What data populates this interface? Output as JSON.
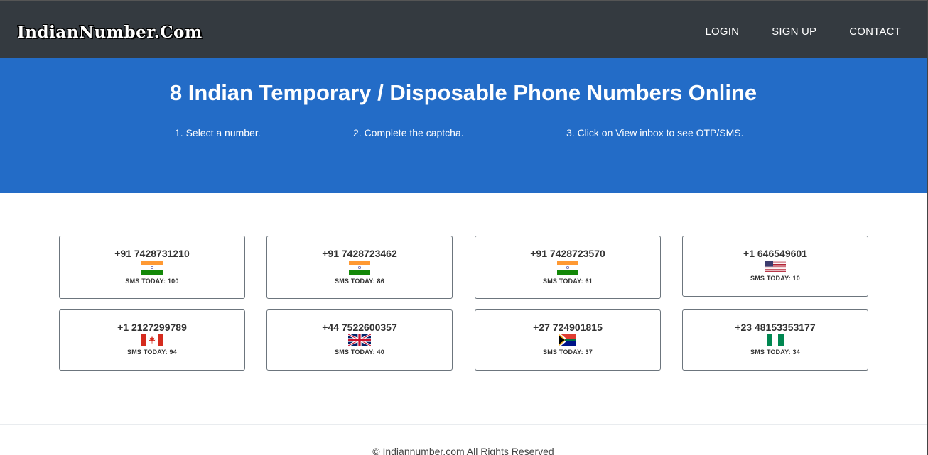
{
  "nav": {
    "brand": "IndianNumber.Com",
    "links": [
      "LOGIN",
      "SIGN UP",
      "CONTACT"
    ]
  },
  "hero": {
    "title": "8 Indian Temporary / Disposable Phone Numbers Online",
    "steps": [
      "1. Select a number.",
      "2. Complete the captcha.",
      "3. Click on View inbox to see OTP/SMS."
    ],
    "color": "#236cc7"
  },
  "numbers": [
    {
      "number": "+91 7428731210",
      "flag": "india-flag",
      "sms": "SMS TODAY: 100"
    },
    {
      "number": "+91 7428723462",
      "flag": "india-flag",
      "sms": "SMS TODAY: 86"
    },
    {
      "number": "+91 7428723570",
      "flag": "india-flag",
      "sms": "SMS TODAY: 61"
    },
    {
      "number": "+1 646549601",
      "flag": "usa-flag",
      "sms": "SMS TODAY: 10"
    },
    {
      "number": "+1 2127299789",
      "flag": "canada-flag",
      "sms": "SMS TODAY: 94"
    },
    {
      "number": "+44 7522600357",
      "flag": "uk-flag",
      "sms": "SMS TODAY: 40"
    },
    {
      "number": "+27 724901815",
      "flag": "south-africa-flag",
      "sms": "SMS TODAY: 37"
    },
    {
      "number": "+23 48153353177",
      "flag": "nigeria-flag",
      "sms": "SMS TODAY: 34"
    }
  ],
  "footer": {
    "text": "© Indiannumber.com All Rights Reserved"
  }
}
